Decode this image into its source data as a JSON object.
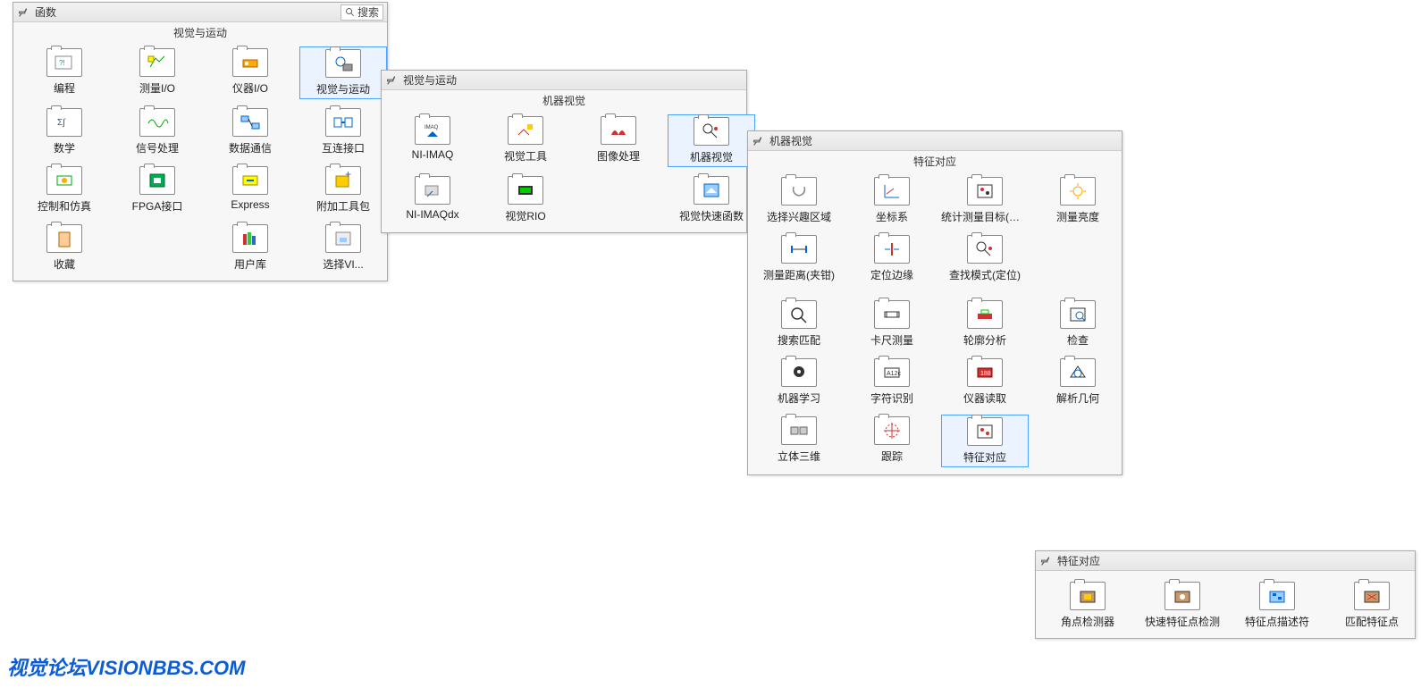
{
  "panel1": {
    "title": "函数",
    "search": "搜索",
    "section": "视觉与运动",
    "items": [
      {
        "label": "编程",
        "icon": "prog"
      },
      {
        "label": "测量I/O",
        "icon": "meas"
      },
      {
        "label": "仪器I/O",
        "icon": "instr"
      },
      {
        "label": "视觉与运动",
        "icon": "vismot",
        "selected": true
      },
      {
        "label": "数学",
        "icon": "math"
      },
      {
        "label": "信号处理",
        "icon": "sig"
      },
      {
        "label": "数据通信",
        "icon": "comm"
      },
      {
        "label": "互连接口",
        "icon": "conn"
      },
      {
        "label": "控制和仿真",
        "icon": "ctrl"
      },
      {
        "label": "FPGA接口",
        "icon": "fpga"
      },
      {
        "label": "Express",
        "icon": "express"
      },
      {
        "label": "附加工具包",
        "icon": "addon"
      },
      {
        "label": "收藏",
        "icon": "fav"
      },
      {
        "label": "",
        "icon": ""
      },
      {
        "label": "用户库",
        "icon": "userlib"
      },
      {
        "label": "选择VI...",
        "icon": "selvi"
      }
    ]
  },
  "panel2": {
    "title": "视觉与运动",
    "section": "机器视觉",
    "items": [
      {
        "label": "NI-IMAQ",
        "icon": "imaq"
      },
      {
        "label": "视觉工具",
        "icon": "vtool"
      },
      {
        "label": "图像处理",
        "icon": "improc"
      },
      {
        "label": "机器视觉",
        "icon": "mvision",
        "selected": true
      },
      {
        "label": "NI-IMAQdx",
        "icon": "imaqd"
      },
      {
        "label": "视觉RIO",
        "icon": "vrio"
      },
      {
        "label": "",
        "icon": ""
      },
      {
        "label": "视觉快速函数",
        "icon": "vfast"
      }
    ]
  },
  "panel3": {
    "title": "机器视觉",
    "section": "特征对应",
    "items": [
      {
        "label": "选择兴趣区域",
        "icon": "roi"
      },
      {
        "label": "坐标系",
        "icon": "coord"
      },
      {
        "label": "统计测量目标(粒子斑点)",
        "icon": "particle"
      },
      {
        "label": "测量亮度",
        "icon": "bright"
      },
      {
        "label": "测量距离(夹钳)",
        "icon": "dist"
      },
      {
        "label": "定位边缘",
        "icon": "edge"
      },
      {
        "label": "查找模式(定位)",
        "icon": "pattern"
      },
      {
        "label": "",
        "icon": ""
      },
      {
        "label": "",
        "icon": ""
      },
      {
        "label": "",
        "icon": ""
      },
      {
        "label": "",
        "icon": ""
      },
      {
        "label": "",
        "icon": ""
      },
      {
        "label": "搜索匹配",
        "icon": "search"
      },
      {
        "label": "卡尺测量",
        "icon": "caliper"
      },
      {
        "label": "轮廓分析",
        "icon": "contour"
      },
      {
        "label": "检查",
        "icon": "inspect"
      },
      {
        "label": "机器学习",
        "icon": "ml"
      },
      {
        "label": "字符识别",
        "icon": "ocr"
      },
      {
        "label": "仪器读取",
        "icon": "instread"
      },
      {
        "label": "解析几何",
        "icon": "geom"
      },
      {
        "label": "立体三维",
        "icon": "stereo"
      },
      {
        "label": "跟踪",
        "icon": "track"
      },
      {
        "label": "特征对应",
        "icon": "feature",
        "selected": true
      }
    ]
  },
  "panel4": {
    "title": "特征对应",
    "items": [
      {
        "label": "角点检测器",
        "icon": "corner"
      },
      {
        "label": "快速特征点检测",
        "icon": "fastf"
      },
      {
        "label": "特征点描述符",
        "icon": "descr"
      },
      {
        "label": "匹配特征点",
        "icon": "match"
      }
    ]
  },
  "watermark": "视觉论坛VISIONBBS.COM"
}
